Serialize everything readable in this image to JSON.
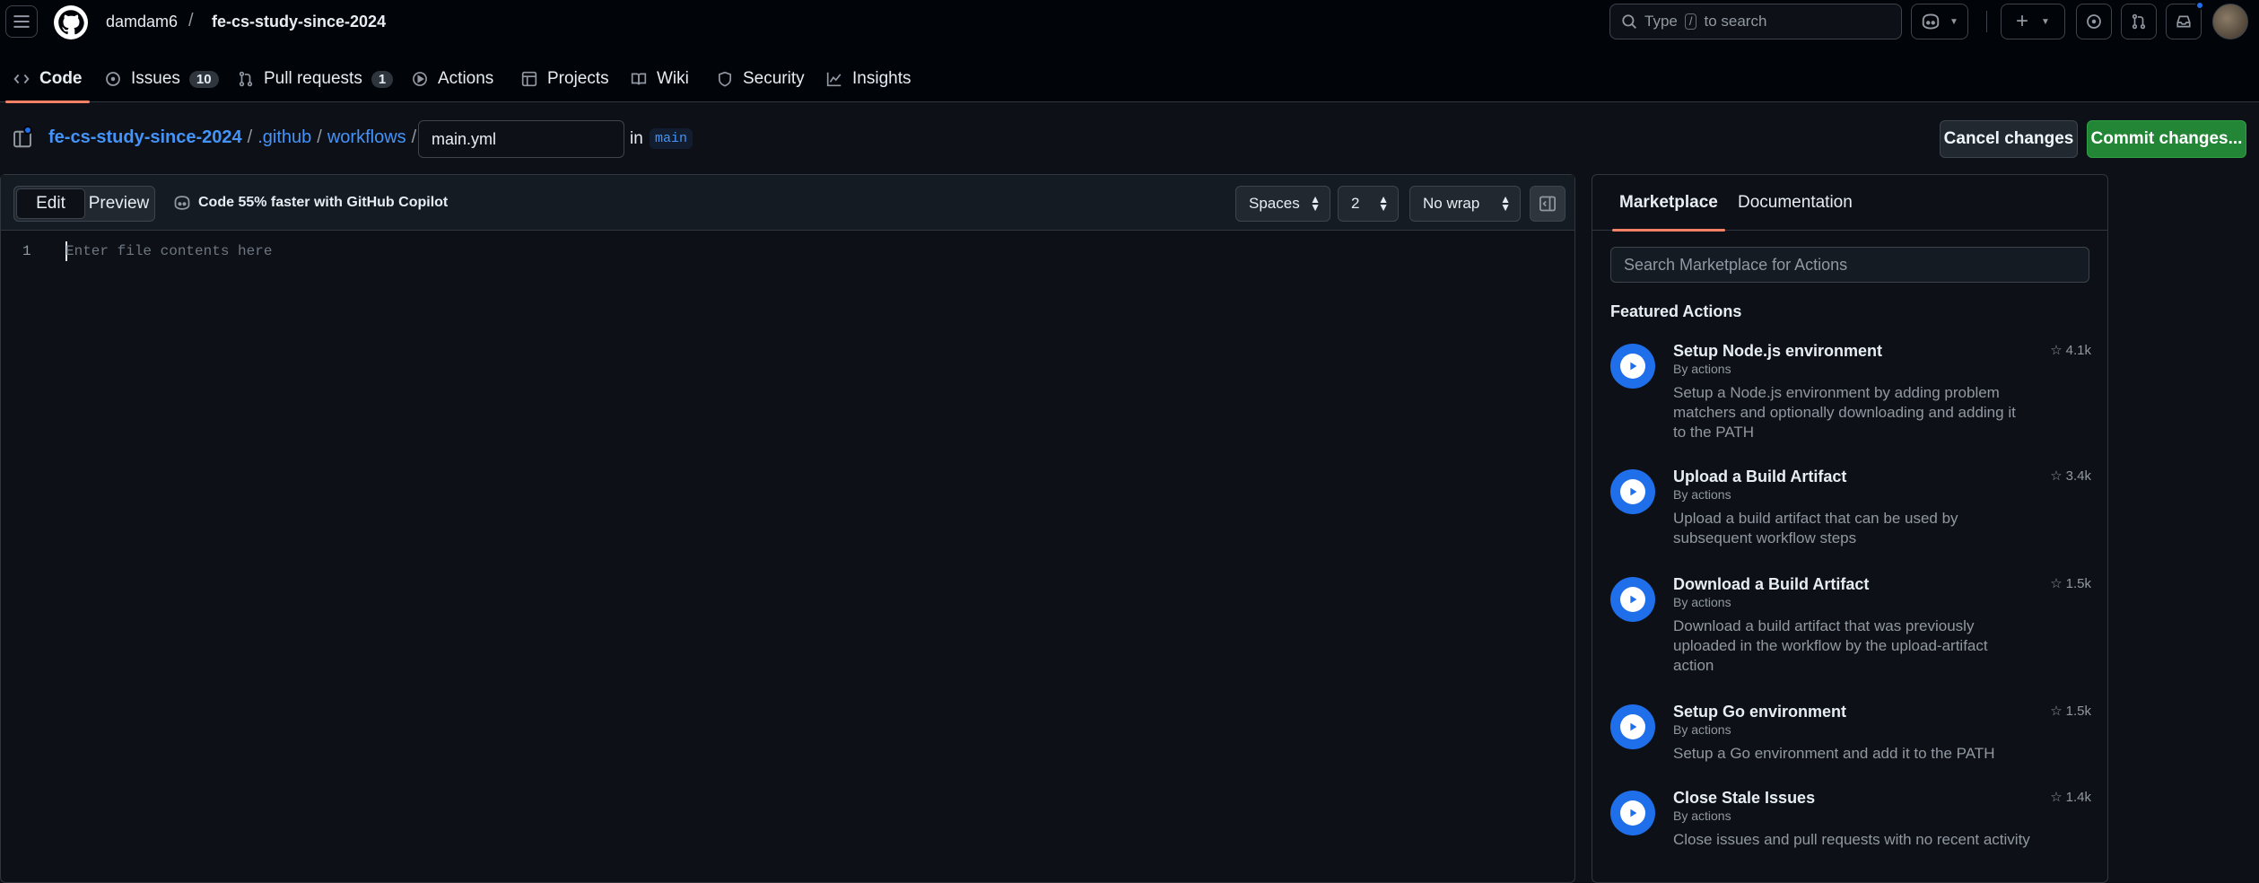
{
  "header": {
    "owner": "damdam6",
    "separator": "/",
    "repo": "fe-cs-study-since-2024",
    "search_prefix": "Type",
    "search_key": "/",
    "search_suffix": "to search"
  },
  "tabs": [
    {
      "label": "Code",
      "icon": "code-icon"
    },
    {
      "label": "Issues",
      "icon": "issue-icon",
      "count": "10"
    },
    {
      "label": "Pull requests",
      "icon": "pull-request-icon",
      "count": "1"
    },
    {
      "label": "Actions",
      "icon": "play-icon"
    },
    {
      "label": "Projects",
      "icon": "table-icon"
    },
    {
      "label": "Wiki",
      "icon": "book-icon"
    },
    {
      "label": "Security",
      "icon": "shield-icon"
    },
    {
      "label": "Insights",
      "icon": "graph-icon"
    }
  ],
  "filebar": {
    "path": [
      "fe-cs-study-since-2024",
      ".github",
      "workflows"
    ],
    "sep": "/",
    "filename": "main.yml",
    "in_label": "in",
    "branch": "main",
    "cancel_label": "Cancel changes",
    "commit_label": "Commit changes..."
  },
  "editor": {
    "edit_label": "Edit",
    "preview_label": "Preview",
    "copilot_hint": "Code 55% faster with GitHub Copilot",
    "indent_mode": "Spaces",
    "indent_size": "2",
    "wrap_mode": "No wrap",
    "line_number": "1",
    "placeholder": "Enter file contents here"
  },
  "marketplace": {
    "tab_marketplace": "Marketplace",
    "tab_documentation": "Documentation",
    "search_placeholder": "Search Marketplace for Actions",
    "featured_title": "Featured Actions",
    "actions": [
      {
        "name": "Setup Node.js environment",
        "by": "By actions",
        "desc": "Setup a Node.js environment by adding problem matchers and optionally downloading and adding it to the PATH",
        "stars": "4.1k"
      },
      {
        "name": "Upload a Build Artifact",
        "by": "By actions",
        "desc": "Upload a build artifact that can be used by subsequent workflow steps",
        "stars": "3.4k"
      },
      {
        "name": "Download a Build Artifact",
        "by": "By actions",
        "desc": "Download a build artifact that was previously uploaded in the workflow by the upload-artifact action",
        "stars": "1.5k"
      },
      {
        "name": "Setup Go environment",
        "by": "By actions",
        "desc": "Setup a Go environment and add it to the PATH",
        "stars": "1.5k"
      },
      {
        "name": "Close Stale Issues",
        "by": "By actions",
        "desc": "Close issues and pull requests with no recent activity",
        "stars": "1.4k"
      }
    ]
  },
  "colors": {
    "accent": "#4493f8",
    "commit_green": "#238636",
    "tab_underline": "#f78166",
    "bg": "#0d1117"
  }
}
